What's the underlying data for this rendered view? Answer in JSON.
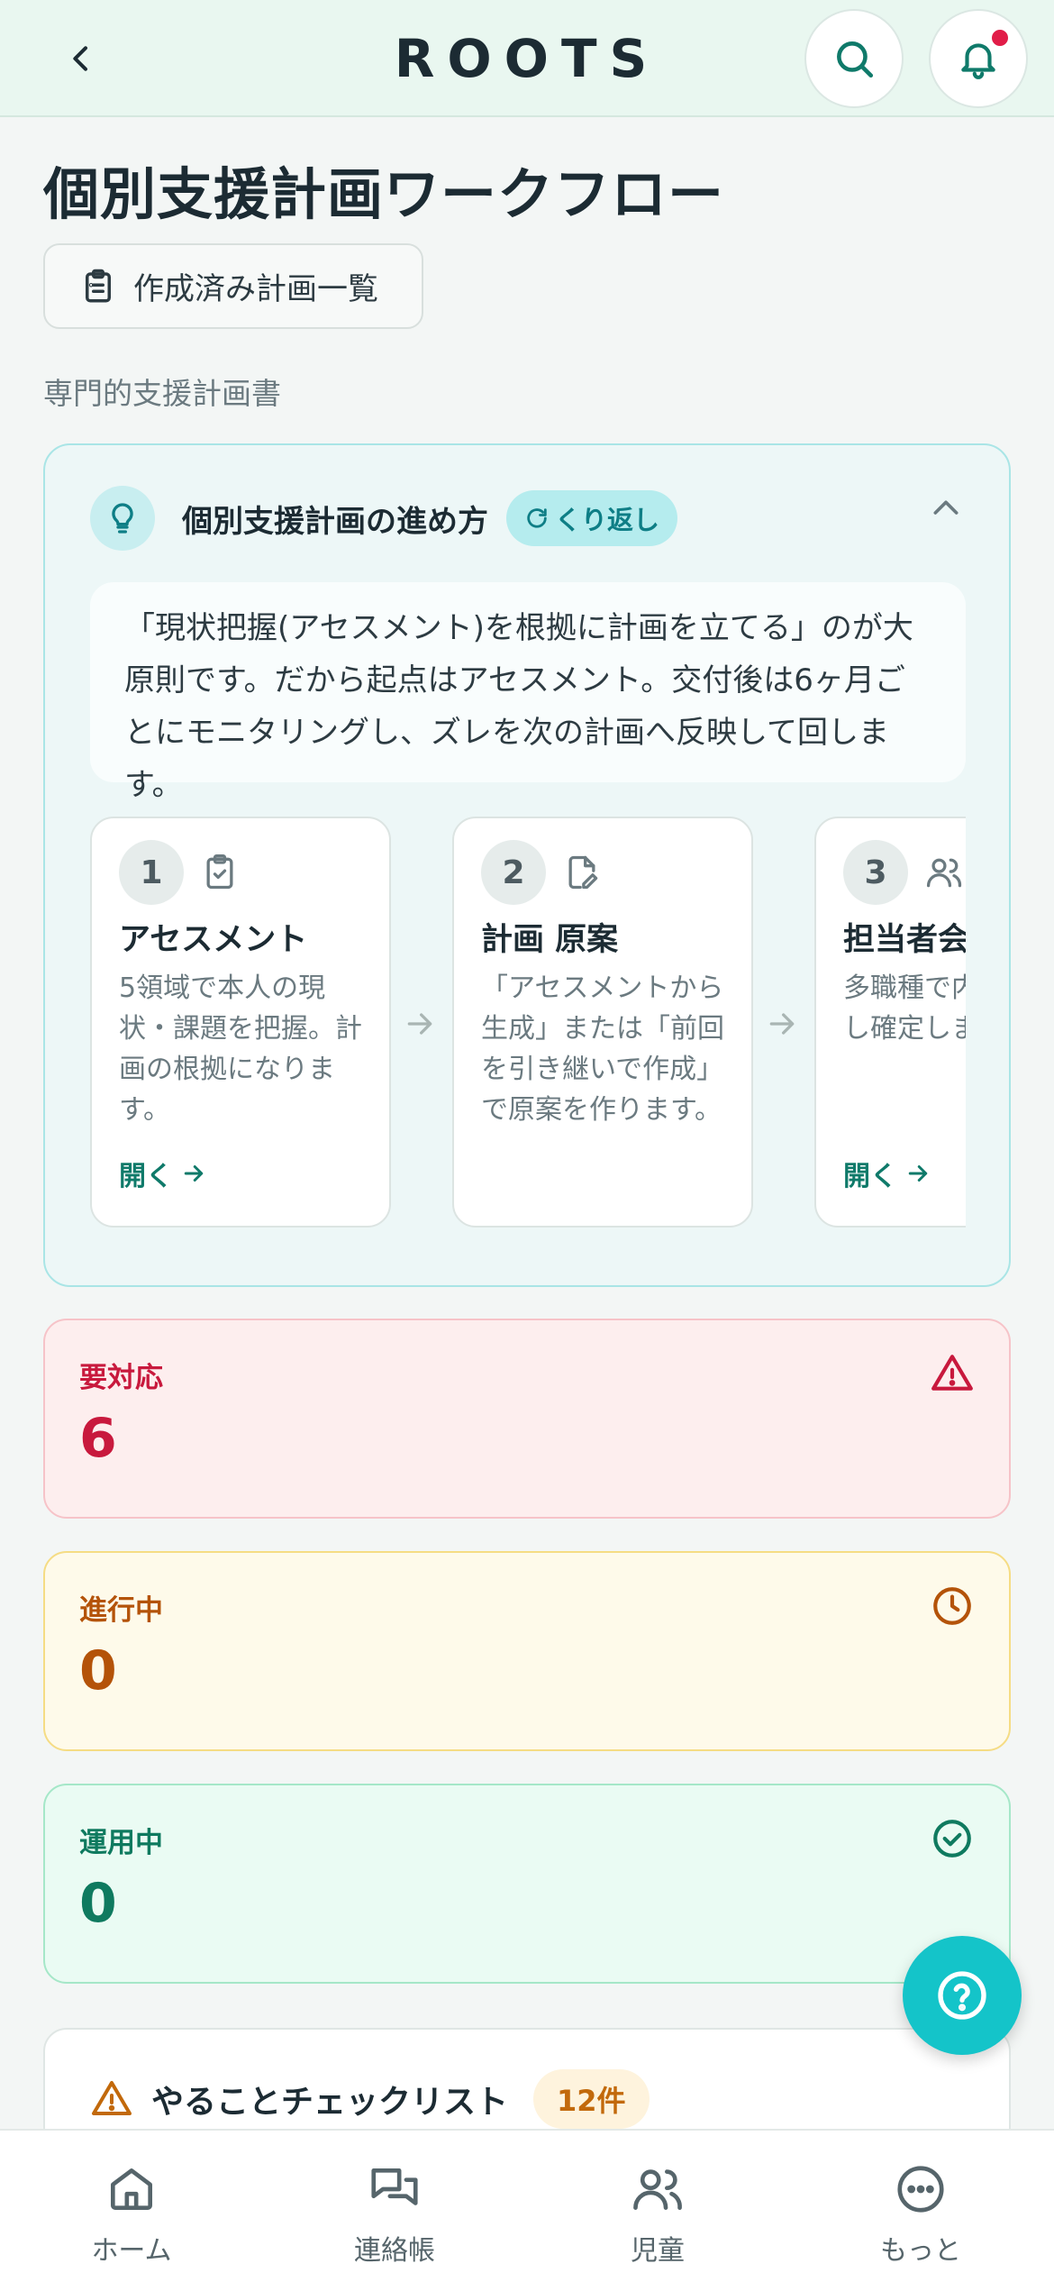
{
  "header": {
    "app_title": "ROOTS"
  },
  "page": {
    "title": "個別支援計画ワークフロー",
    "plans_button_label": "作成済み計画一覧",
    "subtitle": "専門的支援計画書"
  },
  "guide": {
    "title": "個別支援計画の進め方",
    "badge": "くり返し",
    "description": "「現状把握(アセスメント)を根拠に計画を立てる」のが大原則です。だから起点はアセスメント。交付後は6ヶ月ごとにモニタリングし、ズレを次の計画へ反映して回します。",
    "steps": [
      {
        "number": "1",
        "icon": "clipboard-check-icon",
        "title": "アセスメント",
        "description": "5領域で本人の現状・課題を把握。計画の根拠になります。",
        "link": "開く"
      },
      {
        "number": "2",
        "icon": "file-edit-icon",
        "title": "計画 原案",
        "description": "「アセスメントから生成」または「前回を引き継いで作成」で原案を作ります。",
        "link": ""
      },
      {
        "number": "3",
        "icon": "users-icon",
        "title": "担当者会",
        "description": "多職種で内容を検討し確定します。",
        "link": "開く"
      }
    ]
  },
  "status": {
    "urgent": {
      "label": "要対応",
      "value": "6",
      "color": "#c8193d"
    },
    "in_progress": {
      "label": "進行中",
      "value": "0",
      "color": "#b45309"
    },
    "active": {
      "label": "運用中",
      "value": "0",
      "color": "#0f7a5f"
    }
  },
  "checklist": {
    "title": "やることチェックリスト",
    "count": "12件"
  },
  "nav": {
    "items": [
      {
        "label": "ホーム",
        "icon": "home-icon"
      },
      {
        "label": "連絡帳",
        "icon": "messages-icon"
      },
      {
        "label": "児童",
        "icon": "users-icon"
      },
      {
        "label": "もっと",
        "icon": "more-icon"
      }
    ]
  },
  "colors": {
    "accent": "#14c4c9",
    "brand_green": "#0f7a6a",
    "header_bg": "#e9f7f0"
  }
}
